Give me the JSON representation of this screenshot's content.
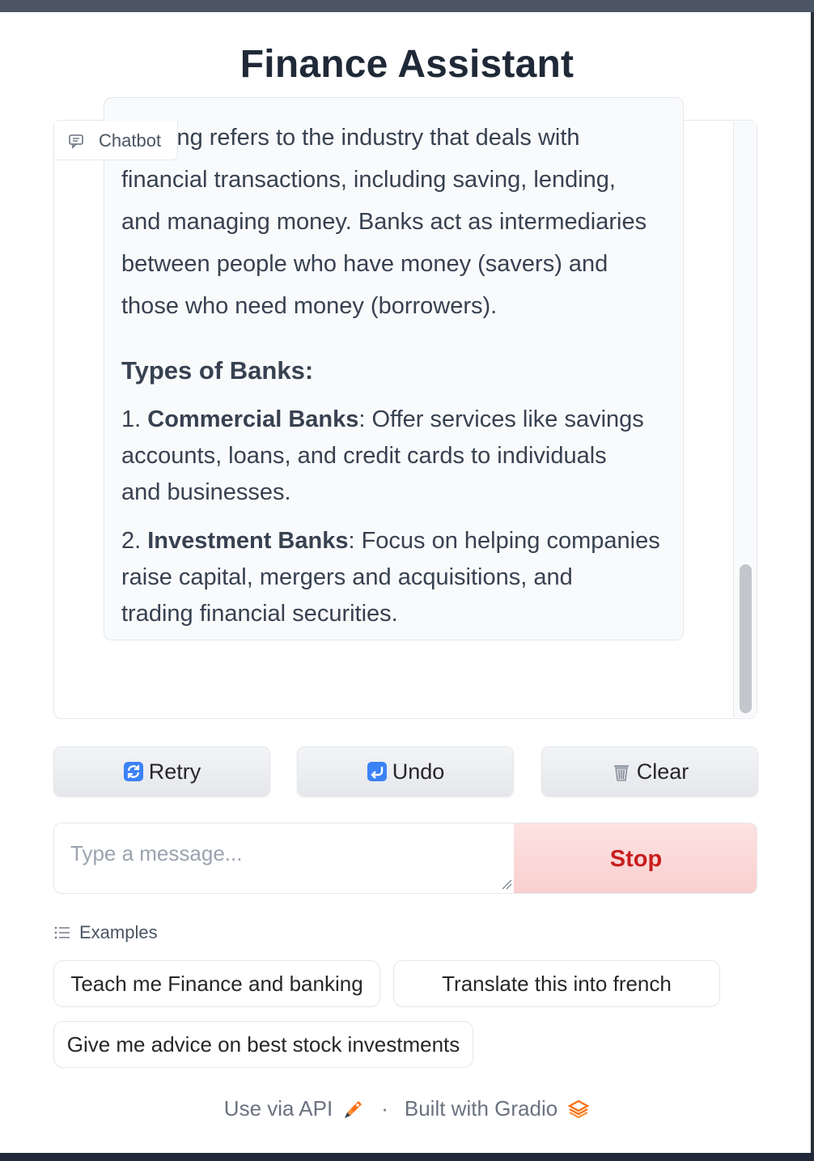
{
  "app": {
    "title": "Finance Assistant"
  },
  "chatbot": {
    "label": "Chatbot",
    "message": {
      "paragraph_lines": [
        "ing refers to the industry that deals with",
        "financial transactions, including saving, lending,",
        "and managing money. Banks act as intermediaries",
        "between people who have money (savers) and",
        "those who need money (borrowers)."
      ],
      "heading": "Types of Banks:",
      "items": [
        {
          "number": "1.",
          "term": "Commercial Banks",
          "first_line": ": Offer services like savings",
          "rest_lines": [
            "accounts, loans, and credit cards to individuals",
            "and businesses."
          ]
        },
        {
          "number": "2.",
          "term": "Investment Banks",
          "first_line": ": Focus on helping companies",
          "rest_lines": [
            "raise capital, mergers and acquisitions, and",
            "trading financial securities."
          ]
        }
      ]
    }
  },
  "actions": {
    "retry": {
      "icon": "retry-icon",
      "label": "Retry"
    },
    "undo": {
      "icon": "undo-icon",
      "label": "Undo"
    },
    "clear": {
      "icon": "trash-icon",
      "label": "Clear"
    }
  },
  "composer": {
    "placeholder": "Type a message...",
    "value": "",
    "stop_label": "Stop"
  },
  "examples": {
    "header": "Examples",
    "items": [
      "Teach me Finance and banking",
      "Translate this into french",
      "Give me advice on best stock investments"
    ]
  },
  "footer": {
    "api_label": "Use via API",
    "separator": "·",
    "built_label": "Built with Gradio"
  },
  "colors": {
    "stop_bg": "#fbd5d5",
    "stop_text": "#c81e1e",
    "title": "#1f2937"
  }
}
